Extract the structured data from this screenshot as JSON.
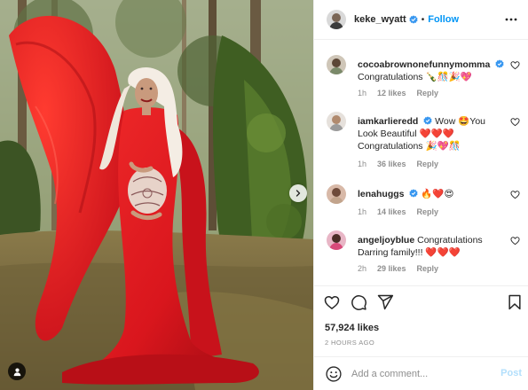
{
  "post": {
    "username": "keke_wyatt",
    "follow_label": "Follow",
    "separator": "•"
  },
  "comments": [
    {
      "username": "cocoabrownonefunnymomma",
      "text": "Congratulations 🍾🎊🎉💖",
      "time": "1h",
      "likes": "12 likes",
      "reply": "Reply",
      "verified": true
    },
    {
      "username": "iamkarlieredd",
      "text": "Wow 🤩You Look Beautiful ❤️❤️❤️Congratulations 🎉💖🎊",
      "time": "1h",
      "likes": "36 likes",
      "reply": "Reply",
      "verified": true
    },
    {
      "username": "lenahuggs",
      "text": "🔥❤️😍",
      "time": "1h",
      "likes": "14 likes",
      "reply": "Reply",
      "verified": true
    },
    {
      "username": "angeljoyblue",
      "text": "Congratulations Darring family!!! ❤️❤️❤️",
      "time": "2h",
      "likes": "29 likes",
      "reply": "Reply",
      "verified": false
    }
  ],
  "actions": {
    "likes_count": "57,924 likes",
    "posted_time": "2 HOURS AGO"
  },
  "add_comment": {
    "placeholder": "Add a comment...",
    "post_label": "Post"
  },
  "icons": {
    "header": [
      "verified-badge-icon",
      "more-options-icon"
    ],
    "actions": [
      "heart-icon",
      "comment-icon",
      "share-icon",
      "bookmark-icon"
    ],
    "photo": [
      "next-arrow-icon",
      "user-tag-icon"
    ],
    "composer": [
      "emoji-icon"
    ]
  },
  "colors": {
    "accent": "#0095f6",
    "post_disabled": "#b2dffc",
    "verified": "#3897f0",
    "dress_red": "#d9161d",
    "muted_text": "#8e8e8e"
  }
}
